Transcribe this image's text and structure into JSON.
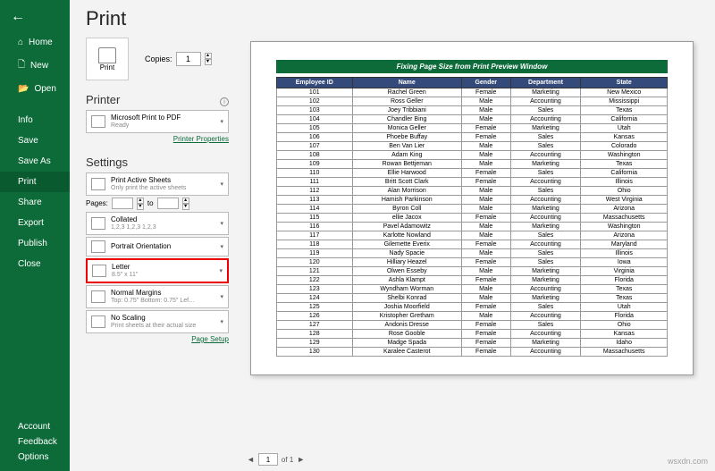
{
  "sidebar": {
    "items": [
      "Home",
      "New",
      "Open"
    ],
    "menu": [
      "Info",
      "Save",
      "Save As",
      "Print",
      "Share",
      "Export",
      "Publish",
      "Close"
    ],
    "bottom": [
      "Account",
      "Feedback",
      "Options"
    ],
    "selected": "Print"
  },
  "title": "Print",
  "print": {
    "label": "Print",
    "copies_label": "Copies:",
    "copies": "1"
  },
  "printer": {
    "header": "Printer",
    "name": "Microsoft Print to PDF",
    "status": "Ready",
    "link": "Printer Properties"
  },
  "settings": {
    "header": "Settings",
    "sheets": {
      "t": "Print Active Sheets",
      "s": "Only print the active sheets"
    },
    "pages": {
      "label": "Pages:",
      "to": "to"
    },
    "collated": {
      "t": "Collated",
      "s": "1,2,3   1,2,3   1,2,3"
    },
    "orient": {
      "t": "Portrait Orientation"
    },
    "size": {
      "t": "Letter",
      "s": "8.5\" x 11\""
    },
    "margins": {
      "t": "Normal Margins",
      "s": "Top: 0.75\" Bottom: 0.75\" Lef…"
    },
    "scaling": {
      "t": "No Scaling",
      "s": "Print sheets at their actual size"
    },
    "link": "Page Setup"
  },
  "preview": {
    "title": "Fixing Page Size from Print Preview Window",
    "headers": [
      "Employee ID",
      "Name",
      "Gender",
      "Department",
      "State"
    ],
    "rows": [
      [
        "101",
        "Rachel Green",
        "Female",
        "Marketing",
        "New Mexico"
      ],
      [
        "102",
        "Ross Geller",
        "Male",
        "Accounting",
        "Mississippi"
      ],
      [
        "103",
        "Joey Tribbiani",
        "Male",
        "Sales",
        "Texas"
      ],
      [
        "104",
        "Chandler Bing",
        "Male",
        "Accounting",
        "California"
      ],
      [
        "105",
        "Monica Geller",
        "Female",
        "Marketing",
        "Utah"
      ],
      [
        "106",
        "Phoebe Buffay",
        "Female",
        "Sales",
        "Kansas"
      ],
      [
        "107",
        "Ben Van Lier",
        "Male",
        "Sales",
        "Colorado"
      ],
      [
        "108",
        "Adam King",
        "Male",
        "Accounting",
        "Washington"
      ],
      [
        "109",
        "Rowan Bettjeman",
        "Male",
        "Marketing",
        "Texas"
      ],
      [
        "110",
        "Ellie Harwood",
        "Female",
        "Sales",
        "California"
      ],
      [
        "111",
        "Britt Scott Clark",
        "Female",
        "Accounting",
        "Illinois"
      ],
      [
        "112",
        "Alan Morrison",
        "Male",
        "Sales",
        "Ohio"
      ],
      [
        "113",
        "Hamish Parkinson",
        "Male",
        "Accounting",
        "West Virginia"
      ],
      [
        "114",
        "Byron Coll",
        "Male",
        "Marketing",
        "Arizona"
      ],
      [
        "115",
        "ellie Jacox",
        "Female",
        "Accounting",
        "Massachusetts"
      ],
      [
        "116",
        "Pavel Adamowitz",
        "Male",
        "Marketing",
        "Washington"
      ],
      [
        "117",
        "Karlotte Nowland",
        "Male",
        "Sales",
        "Arizona"
      ],
      [
        "118",
        "Gilemette Everix",
        "Female",
        "Accounting",
        "Maryland"
      ],
      [
        "119",
        "Nady Spacie",
        "Male",
        "Sales",
        "Illinois"
      ],
      [
        "120",
        "Hilliary Heazel",
        "Female",
        "Sales",
        "Iowa"
      ],
      [
        "121",
        "Olwen Esseby",
        "Male",
        "Marketing",
        "Virginia"
      ],
      [
        "122",
        "Ashla Klampt",
        "Female",
        "Marketing",
        "Florida"
      ],
      [
        "123",
        "Wyndham Worman",
        "Male",
        "Accounting",
        "Texas"
      ],
      [
        "124",
        "Shelbi Konrad",
        "Male",
        "Marketing",
        "Texas"
      ],
      [
        "125",
        "Joshia Moorfield",
        "Female",
        "Sales",
        "Utah"
      ],
      [
        "126",
        "Kristopher Gretham",
        "Male",
        "Accounting",
        "Florida"
      ],
      [
        "127",
        "Andonis Dresse",
        "Female",
        "Sales",
        "Ohio"
      ],
      [
        "128",
        "Rose Gooble",
        "Female",
        "Accounting",
        "Kansas"
      ],
      [
        "129",
        "Madge Spada",
        "Female",
        "Marketing",
        "Idaho"
      ],
      [
        "130",
        "Karalee Casterot",
        "Female",
        "Accounting",
        "Massachusetts"
      ]
    ]
  },
  "pager": {
    "page": "1",
    "total": "of 1"
  },
  "watermark": "wsxdn.com"
}
